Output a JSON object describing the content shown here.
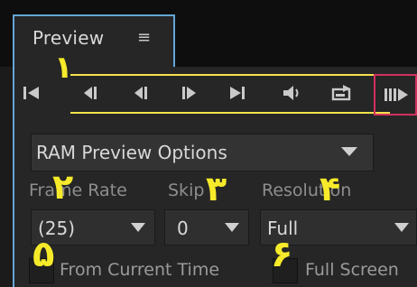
{
  "tab": {
    "title": "Preview",
    "menu_glyph": "≡"
  },
  "transport": {
    "buttons": [
      {
        "name": "first-frame-button",
        "glyph": "first-frame"
      },
      {
        "name": "previous-frame-button",
        "glyph": "prev-frame"
      },
      {
        "name": "play-backward-button",
        "glyph": "play-back"
      },
      {
        "name": "play-pause-button",
        "glyph": "play"
      },
      {
        "name": "next-frame-button",
        "glyph": "next-frame"
      },
      {
        "name": "mute-audio-button",
        "glyph": "speaker"
      },
      {
        "name": "loop-button",
        "glyph": "loop"
      },
      {
        "name": "ram-preview-button",
        "glyph": "ram-preview"
      }
    ]
  },
  "options": {
    "title": "RAM Preview Options"
  },
  "fields": {
    "frame_rate_label": "Frame Rate",
    "frame_rate_value": "(25)",
    "skip_label": "Skip",
    "skip_value": "0",
    "resolution_label": "Resolution",
    "resolution_value": "Full"
  },
  "checkboxes": {
    "from_current_label": "From Current Time",
    "full_screen_label": "Full Screen"
  },
  "annotations": {
    "one": "١",
    "two": "٢",
    "three": "٣",
    "four": "۴",
    "five": "۵",
    "six": "۶"
  },
  "colors": {
    "accent_tab": "#64a6d6",
    "annotation_yellow": "#f6ea2a",
    "ram_button_border": "#d2305f",
    "panel_bg": "#262626"
  }
}
